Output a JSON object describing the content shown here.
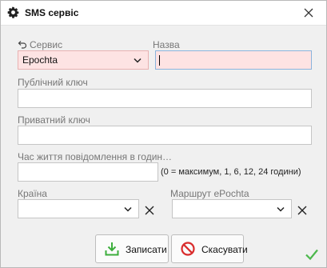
{
  "window": {
    "title": "SMS сервіс"
  },
  "form": {
    "service_label": "Сервис",
    "service_value": "Epochta",
    "name_label": "Назва",
    "name_value": "",
    "public_key_label": "Публічний ключ",
    "public_key_value": "",
    "private_key_label": "Приватний ключ",
    "private_key_value": "",
    "ttl_label": "Час життя повідомлення в годин…",
    "ttl_value": "",
    "ttl_note": "(0 = максимум, 1, 6, 12, 24 години)",
    "country_label": "Країна",
    "country_value": "",
    "route_label": "Маршрут ePochta",
    "route_value": ""
  },
  "buttons": {
    "save_label": "Записати",
    "cancel_label": "Скасувати"
  },
  "colors": {
    "required_bg": "#fde3e3",
    "save_icon": "#3cae3c",
    "cancel_icon": "#d92c2c",
    "check": "#4cb84c"
  },
  "icons": {
    "title": "gear-icon",
    "close": "close-icon",
    "back": "back-arrow-icon",
    "dropdown": "chevron-down-icon",
    "clear": "clear-x-icon",
    "save": "download-save-icon",
    "cancel": "no-entry-icon",
    "status": "checkmark-icon"
  }
}
